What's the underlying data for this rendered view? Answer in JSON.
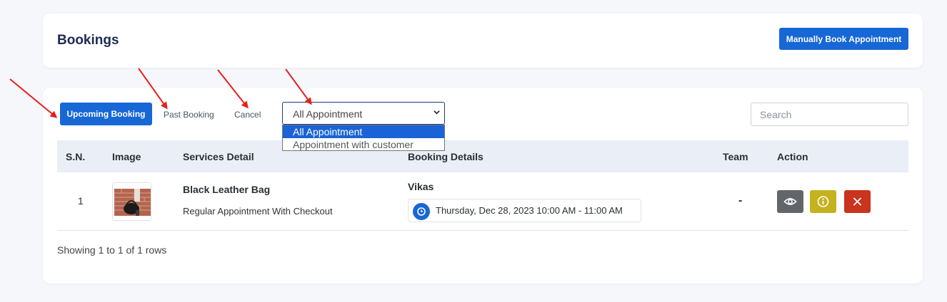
{
  "header": {
    "title": "Bookings",
    "manual_book_label": "Manually Book Appointment"
  },
  "tabs": {
    "upcoming": "Upcoming Booking",
    "past": "Past Booking",
    "cancel": "Cancel"
  },
  "filter": {
    "selected": "All Appointment",
    "options": [
      "All Appointment",
      "Appointment with customer"
    ]
  },
  "search": {
    "placeholder": "Search"
  },
  "table": {
    "columns": [
      "S.N.",
      "Image",
      "Services Detail",
      "Booking Details",
      "Team",
      "Action"
    ],
    "rows": [
      {
        "sn": "1",
        "service_title": "Black Leather Bag",
        "service_type": "Regular Appointment With Checkout",
        "customer": "Vikas",
        "datetime": "Thursday, Dec 28, 2023 10:00 AM - 11:00 AM",
        "team": "-"
      }
    ]
  },
  "footer": {
    "summary": "Showing 1 to 1 of 1 rows"
  },
  "colors": {
    "primary": "#1767d6",
    "view_button": "#62666b",
    "info_button": "#c4b21e",
    "delete_button": "#c8341d",
    "annotation_arrow": "#e8201c"
  }
}
